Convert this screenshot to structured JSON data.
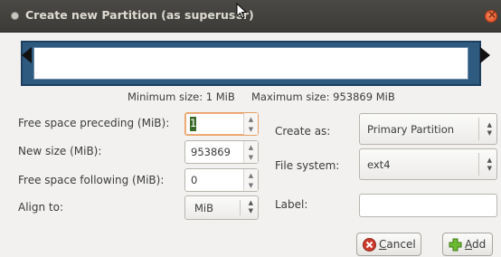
{
  "window": {
    "title": "Create new Partition (as superuser)"
  },
  "sizes": {
    "minimum": "Minimum size: 1 MiB",
    "maximum": "Maximum size: 953869 MiB"
  },
  "fields": {
    "free_preceding": {
      "label": "Free space preceding (MiB):",
      "value": "1"
    },
    "new_size": {
      "label": "New size (MiB):",
      "value": "953869"
    },
    "free_following": {
      "label": "Free space following (MiB):",
      "value": "0"
    },
    "align_to": {
      "label": "Align to:",
      "value": "MiB"
    },
    "create_as": {
      "label": "Create as:",
      "value": "Primary Partition"
    },
    "file_system": {
      "label": "File system:",
      "value": "ext4"
    },
    "partition_label": {
      "label": "Label:",
      "value": ""
    }
  },
  "buttons": {
    "cancel": {
      "underlined": "C",
      "rest": "ancel",
      "icon": "cancel-icon"
    },
    "add": {
      "underlined": "A",
      "rest": "dd",
      "icon": "add-icon"
    }
  },
  "colors": {
    "partition_bar": "#2f5a80",
    "titlebar": "#3c3b37",
    "close_button": "#df4a21",
    "focus_ring": "#e8a063",
    "add_icon": "#4e9a06",
    "cancel_icon": "#cc3b2c"
  }
}
